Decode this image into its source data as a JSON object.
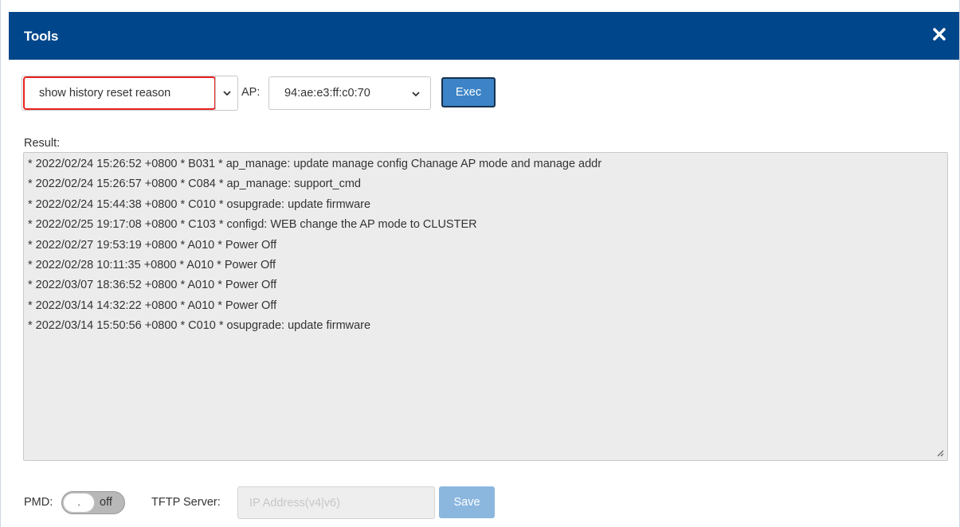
{
  "dialog": {
    "title": "Tools",
    "close_icon": "close-icon"
  },
  "controls": {
    "command_value": "show history reset reason",
    "ap_label": "AP:",
    "ap_value": "94:ae:e3:ff:c0:70",
    "exec_label": "Exec"
  },
  "result": {
    "label": "Result:",
    "lines": [
      "* 2022/02/24 15:26:52 +0800 * B031 * ap_manage: update manage config Chanage AP mode and manage addr",
      "* 2022/02/24 15:26:57 +0800 * C084 * ap_manage: support_cmd",
      "* 2022/02/24 15:44:38 +0800 * C010 * osupgrade: update firmware",
      "* 2022/02/25 19:17:08 +0800 * C103 * configd: WEB change the AP mode to CLUSTER",
      "* 2022/02/27 19:53:19 +0800 * A010 * Power Off",
      "* 2022/02/28 10:11:35 +0800 * A010 * Power Off",
      "* 2022/03/07 18:36:52 +0800 * A010 * Power Off",
      "* 2022/03/14 14:32:22 +0800 * A010 * Power Off",
      "* 2022/03/14 15:50:56 +0800 * C010 * osupgrade: update firmware"
    ]
  },
  "footer": {
    "pmd_label": "PMD:",
    "pmd_knob": ".",
    "pmd_state": "off",
    "tftp_label": "TFTP Server:",
    "tftp_placeholder": "IP Address(v4|v6)",
    "save_label": "Save"
  },
  "colors": {
    "titlebar": "#00468b",
    "highlight": "#e8231f",
    "exec_button": "#3c84c7",
    "save_button": "#8bb7df"
  }
}
